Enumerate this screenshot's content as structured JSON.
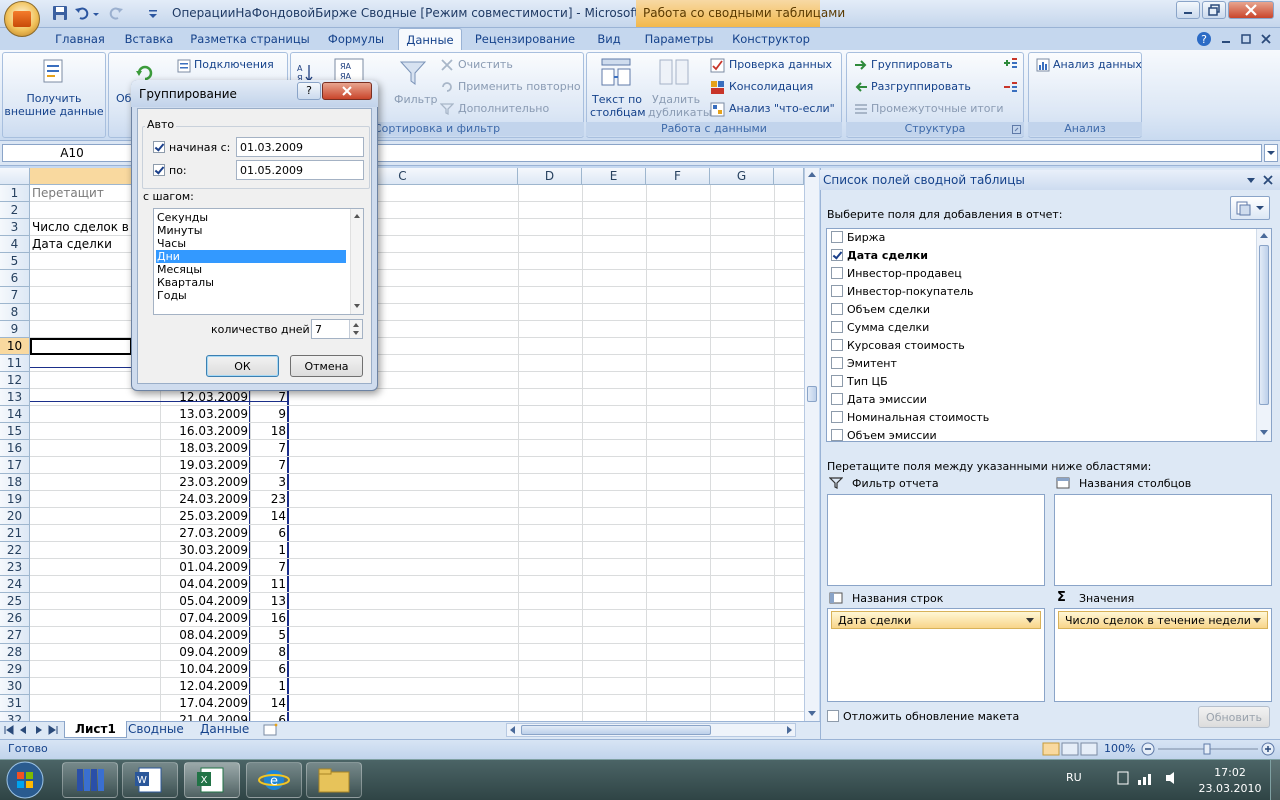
{
  "window": {
    "title": "ОперацииНаФондовойБирже  Сводные  [Режим совместимости] - Microsoft Ex...",
    "context_tab": "Работа со сводными таблицами"
  },
  "tabs": [
    "Главная",
    "Вставка",
    "Разметка страницы",
    "Формулы",
    "Данные",
    "Рецензирование",
    "Вид",
    "Параметры",
    "Конструктор"
  ],
  "active_tab": "Данные",
  "ribbon": {
    "get_external": {
      "line1": "Получить",
      "line2": "внешние данные"
    },
    "refresh_partial": "Об",
    "connections": "Подключения",
    "sort_filter_group": "Сортировка и фильтр",
    "filter": "Фильтр",
    "clear": "Очистить",
    "reapply": "Применить повторно",
    "advanced": "Дополнительно",
    "text_to_columns": {
      "line1": "Текст по",
      "line2": "столбцам"
    },
    "remove_dups": {
      "line1": "Удалить",
      "line2": "дубликаты"
    },
    "data_validation": "Проверка данных",
    "consolidate": "Консолидация",
    "what_if": "Анализ \"что-если\"",
    "data_tools_group": "Работа с данными",
    "group": "Группировать",
    "ungroup": "Разгруппировать",
    "subtotal": "Промежуточные итоги",
    "outline_group": "Структура",
    "data_analysis": "Анализ данных",
    "analysis_group": "Анализ"
  },
  "namebox": "A10",
  "columns": {
    "a": "",
    "b": "",
    "c": "C",
    "d": "D",
    "e": "E",
    "f": "F",
    "g": "G"
  },
  "rows": [
    {
      "n": "1",
      "a": "Перетащит",
      "b": "",
      "c": ""
    },
    {
      "n": "2",
      "a": "",
      "b": "",
      "c": ""
    },
    {
      "n": "3",
      "a": "Число сделок в",
      "b": "",
      "c": ""
    },
    {
      "n": "4",
      "a": "Дата сделки",
      "b": "",
      "c": ""
    },
    {
      "n": "5",
      "a": "",
      "b": "",
      "c": ""
    },
    {
      "n": "6",
      "a": "",
      "b": "",
      "c": ""
    },
    {
      "n": "7",
      "a": "",
      "b": "",
      "c": ""
    },
    {
      "n": "8",
      "a": "",
      "b": "",
      "c": ""
    },
    {
      "n": "9",
      "a": "",
      "b": "",
      "c": ""
    },
    {
      "n": "10",
      "a": "",
      "b": "",
      "c": ""
    },
    {
      "n": "11",
      "a": "",
      "b": "",
      "c": ""
    },
    {
      "n": "12",
      "a": "",
      "b": "",
      "c": ""
    },
    {
      "n": "13",
      "a": "",
      "b": "12.03.2009",
      "c": "7"
    },
    {
      "n": "14",
      "a": "",
      "b": "13.03.2009",
      "c": "9"
    },
    {
      "n": "15",
      "a": "",
      "b": "16.03.2009",
      "c": "18"
    },
    {
      "n": "16",
      "a": "",
      "b": "18.03.2009",
      "c": "7"
    },
    {
      "n": "17",
      "a": "",
      "b": "19.03.2009",
      "c": "7"
    },
    {
      "n": "18",
      "a": "",
      "b": "23.03.2009",
      "c": "3"
    },
    {
      "n": "19",
      "a": "",
      "b": "24.03.2009",
      "c": "23"
    },
    {
      "n": "20",
      "a": "",
      "b": "25.03.2009",
      "c": "14"
    },
    {
      "n": "21",
      "a": "",
      "b": "27.03.2009",
      "c": "6"
    },
    {
      "n": "22",
      "a": "",
      "b": "30.03.2009",
      "c": "1"
    },
    {
      "n": "23",
      "a": "",
      "b": "01.04.2009",
      "c": "7"
    },
    {
      "n": "24",
      "a": "",
      "b": "04.04.2009",
      "c": "11"
    },
    {
      "n": "25",
      "a": "",
      "b": "05.04.2009",
      "c": "13"
    },
    {
      "n": "26",
      "a": "",
      "b": "07.04.2009",
      "c": "16"
    },
    {
      "n": "27",
      "a": "",
      "b": "08.04.2009",
      "c": "5"
    },
    {
      "n": "28",
      "a": "",
      "b": "09.04.2009",
      "c": "8"
    },
    {
      "n": "29",
      "a": "",
      "b": "10.04.2009",
      "c": "6"
    },
    {
      "n": "30",
      "a": "",
      "b": "12.04.2009",
      "c": "1"
    },
    {
      "n": "31",
      "a": "",
      "b": "17.04.2009",
      "c": "14"
    },
    {
      "n": "32",
      "a": "",
      "b": "21.04.2009",
      "c": "6"
    }
  ],
  "sheets": [
    "Лист1",
    "Сводные",
    "Данные"
  ],
  "active_sheet": "Лист1",
  "status": {
    "ready": "Готово",
    "zoom": "100%"
  },
  "dialog": {
    "title": "Группирование",
    "help": "?",
    "auto_label": "Авто",
    "start_label": "начиная с:",
    "start_value": "01.03.2009",
    "start_checked": true,
    "end_label": "по:",
    "end_value": "01.05.2009",
    "end_checked": true,
    "step_label": "с шагом:",
    "steps": [
      "Секунды",
      "Минуты",
      "Часы",
      "Дни",
      "Месяцы",
      "Кварталы",
      "Годы"
    ],
    "selected_step": "Дни",
    "days_label": "количество дней:",
    "days_value": "7",
    "ok": "ОК",
    "cancel": "Отмена"
  },
  "pivot_pane": {
    "title": "Список полей сводной таблицы",
    "choose_label": "Выберите поля для добавления в отчет:",
    "fields": [
      {
        "name": "Биржа",
        "checked": false
      },
      {
        "name": "Дата сделки",
        "checked": true
      },
      {
        "name": "Инвестор-продавец",
        "checked": false
      },
      {
        "name": "Инвестор-покупатель",
        "checked": false
      },
      {
        "name": "Объем сделки",
        "checked": false
      },
      {
        "name": "Сумма сделки",
        "checked": false
      },
      {
        "name": "Курсовая стоимость",
        "checked": false
      },
      {
        "name": "Эмитент",
        "checked": false
      },
      {
        "name": "Тип ЦБ",
        "checked": false
      },
      {
        "name": "Дата эмиссии",
        "checked": false
      },
      {
        "name": "Номинальная стоимость",
        "checked": false
      },
      {
        "name": "Объем эмиссии",
        "checked": false
      }
    ],
    "drag_label": "Перетащите поля между указанными ниже областями:",
    "report_filter": "Фильтр отчета",
    "column_labels": "Названия столбцов",
    "row_labels": "Названия строк",
    "values": "Значения",
    "row_item": "Дата сделки",
    "value_item": "Число сделок в течение недели",
    "defer_label": "Отложить обновление макета",
    "update_button": "Обновить"
  },
  "taskbar": {
    "lang": "RU",
    "time": "17:02",
    "date": "23.03.2010"
  }
}
